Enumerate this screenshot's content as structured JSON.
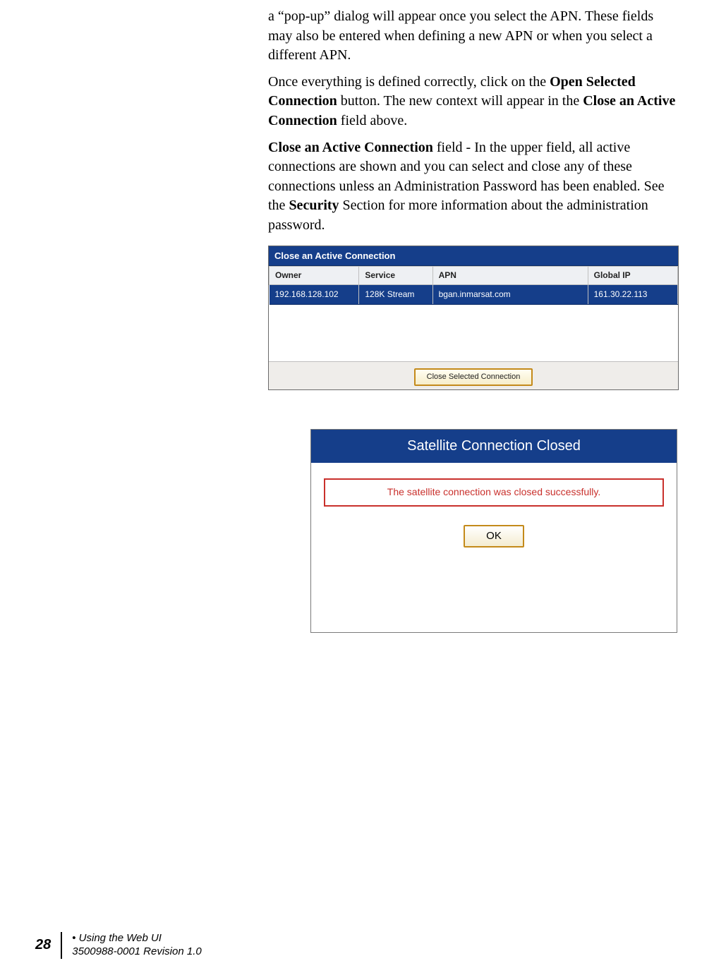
{
  "paragraphs": {
    "p1": "a “pop-up” dialog will appear once you select the APN.  These fields may also be entered when defining a new APN or when you select a different APN.",
    "p2_a": "Once everything is defined correctly, click on the ",
    "p2_b": "Open Selected Connection",
    "p2_c": " button.  The new context will appear in the ",
    "p2_d": "Close an Active Connection",
    "p2_e": " field above.",
    "p3_a": "Close an Active Connection",
    "p3_b": " field - In the upper field, all active connections are shown and you can select and close any of these connections unless an Administration Password has been enabled.  See the ",
    "p3_c": "Security",
    "p3_d": " Section for more information about the administration password."
  },
  "panel": {
    "title": "Close an Active Connection",
    "headers": [
      "Owner",
      "Service",
      "APN",
      "Global IP"
    ],
    "row": [
      "192.168.128.102",
      "128K Stream",
      "bgan.inmarsat.com",
      "161.30.22.113"
    ],
    "button": "Close Selected Connection"
  },
  "dialog": {
    "title": "Satellite Connection Closed",
    "message": "The satellite connection was closed successfully.",
    "ok": "OK"
  },
  "footer": {
    "page": "28",
    "line1a": "• ",
    "line1b": "Using the Web UI",
    "line2": "3500988-0001  Revision 1.0"
  }
}
